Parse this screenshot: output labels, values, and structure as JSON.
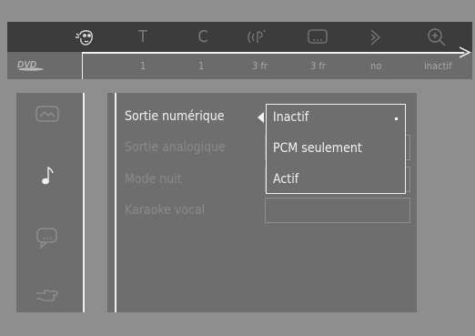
{
  "topbar": {
    "icons": [
      {
        "name": "settings-profile-icon",
        "active": true
      },
      {
        "name": "title-icon",
        "glyph": "T"
      },
      {
        "name": "chapter-icon",
        "glyph": "C"
      },
      {
        "name": "audio-icon"
      },
      {
        "name": "subtitle-icon"
      },
      {
        "name": "angle-icon"
      },
      {
        "name": "zoom-icon"
      }
    ]
  },
  "statusbar": {
    "logo": "DVD",
    "values": [
      "1",
      "1",
      "3 fr",
      "3 fr",
      "no",
      "inactif"
    ]
  },
  "sidebar": {
    "icons": [
      {
        "name": "picture-icon",
        "active": false
      },
      {
        "name": "music-note-icon",
        "active": true
      },
      {
        "name": "speech-bubble-icon",
        "active": false
      },
      {
        "name": "hand-pointer-icon",
        "active": false
      }
    ]
  },
  "menu": {
    "rows": [
      {
        "label": "Sortie numérique",
        "active": true
      },
      {
        "label": "Sortie analogique",
        "active": false
      },
      {
        "label": "Mode nuit",
        "active": false
      },
      {
        "label": "Karaoke vocal",
        "active": false
      }
    ],
    "dropdown": {
      "options": [
        "Inactif",
        "PCM seulement",
        "Actif"
      ],
      "selected": "Inactif"
    }
  },
  "colors": {
    "background": "#8e8e8e",
    "topbar": "#3c3c3c",
    "panel": "#6e6e6e",
    "highlight": "#f0f0f0",
    "dim_text": "#8a8a8a"
  }
}
